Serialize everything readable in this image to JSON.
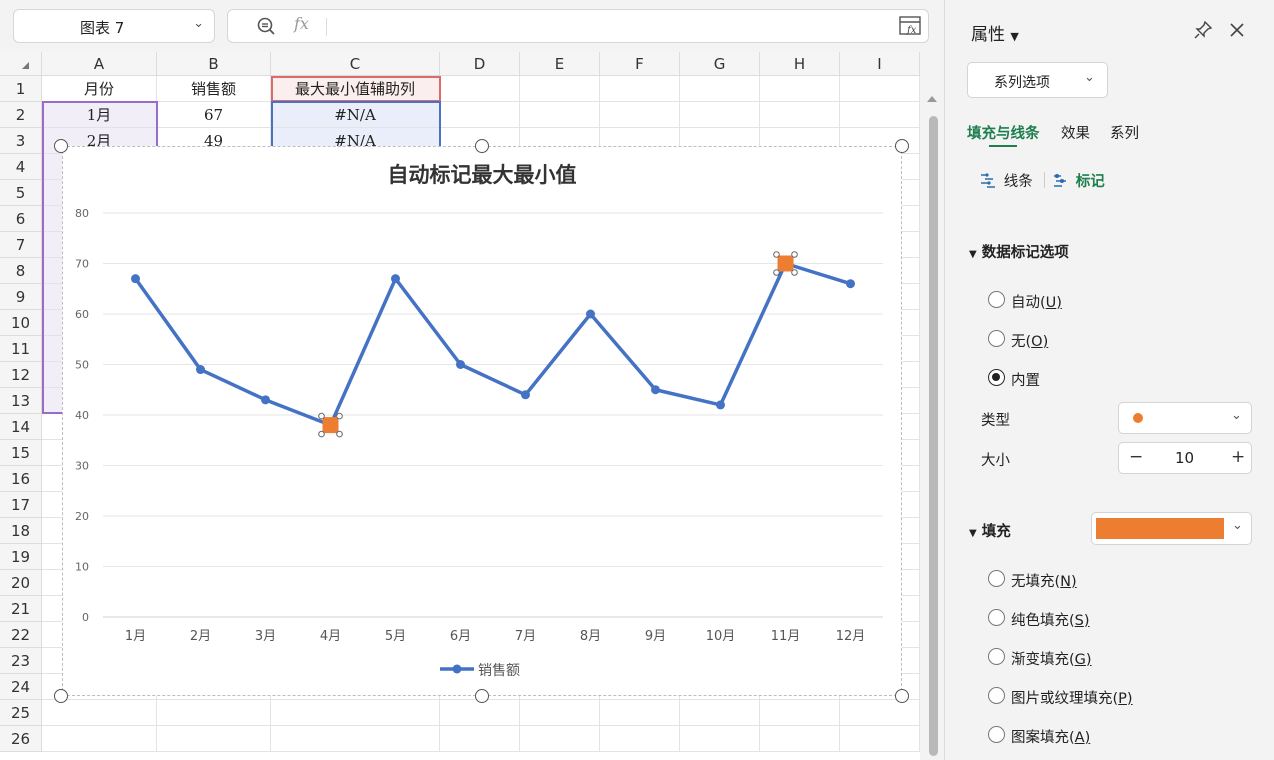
{
  "formula_bar": {
    "name_box": "图表 7",
    "formula": ""
  },
  "columns": [
    "A",
    "B",
    "C",
    "D",
    "E",
    "F",
    "G",
    "H",
    "I"
  ],
  "rows": [
    "1",
    "2",
    "3",
    "4",
    "5",
    "6",
    "7",
    "8",
    "9",
    "10",
    "11",
    "12",
    "13",
    "14",
    "15",
    "16",
    "17",
    "18",
    "19",
    "20",
    "21",
    "22",
    "23",
    "24",
    "25",
    "26"
  ],
  "cells": {
    "A1": "月份",
    "B1": "销售额",
    "C1": "最大最小值辅助列",
    "A2": "1月",
    "B2": "67",
    "C2": "#N/A",
    "A3": "2月",
    "B3": "49",
    "C3": "#N/A"
  },
  "chart_data": {
    "type": "line",
    "title": "自动标记最大最小值",
    "categories": [
      "1月",
      "2月",
      "3月",
      "4月",
      "5月",
      "6月",
      "7月",
      "8月",
      "9月",
      "10月",
      "11月",
      "12月"
    ],
    "series": [
      {
        "name": "销售额",
        "values": [
          67,
          49,
          43,
          38,
          67,
          50,
          44,
          60,
          45,
          42,
          70,
          66
        ]
      }
    ],
    "highlight": {
      "min": {
        "category": "4月",
        "value": 38
      },
      "max": {
        "category": "11月",
        "value": 70
      }
    },
    "yticks": [
      "0",
      "10",
      "20",
      "30",
      "40",
      "50",
      "60",
      "70",
      "80"
    ],
    "ylim": [
      0,
      80
    ],
    "grid": true,
    "legend": "bottom",
    "series_color": "#4472c4",
    "marker_color": "#ed7d31"
  },
  "panel": {
    "title": "属性",
    "series_options": "系列选项",
    "tabs": [
      "填充与线条",
      "效果",
      "系列"
    ],
    "subtabs": {
      "line": "线条",
      "marker": "标记"
    },
    "marker_section": "数据标记选项",
    "marker_options": {
      "auto": "自动(",
      "auto_key": "U",
      "none": "无(",
      "none_key": "O",
      "builtin": "内置"
    },
    "type_label": "类型",
    "size_label": "大小",
    "size_value": "10",
    "fill_section": "填充",
    "fill_color": "#ed7d31",
    "fill_options": [
      {
        "text": "无填充(",
        "key": "N"
      },
      {
        "text": "纯色填充(",
        "key": "S"
      },
      {
        "text": "渐变填充(",
        "key": "G"
      },
      {
        "text": "图片或纹理填充(",
        "key": "P"
      },
      {
        "text": "图案填充(",
        "key": "A"
      }
    ],
    "close_paren": ")"
  },
  "colors": {
    "accent_green": "#1e7e4e"
  }
}
